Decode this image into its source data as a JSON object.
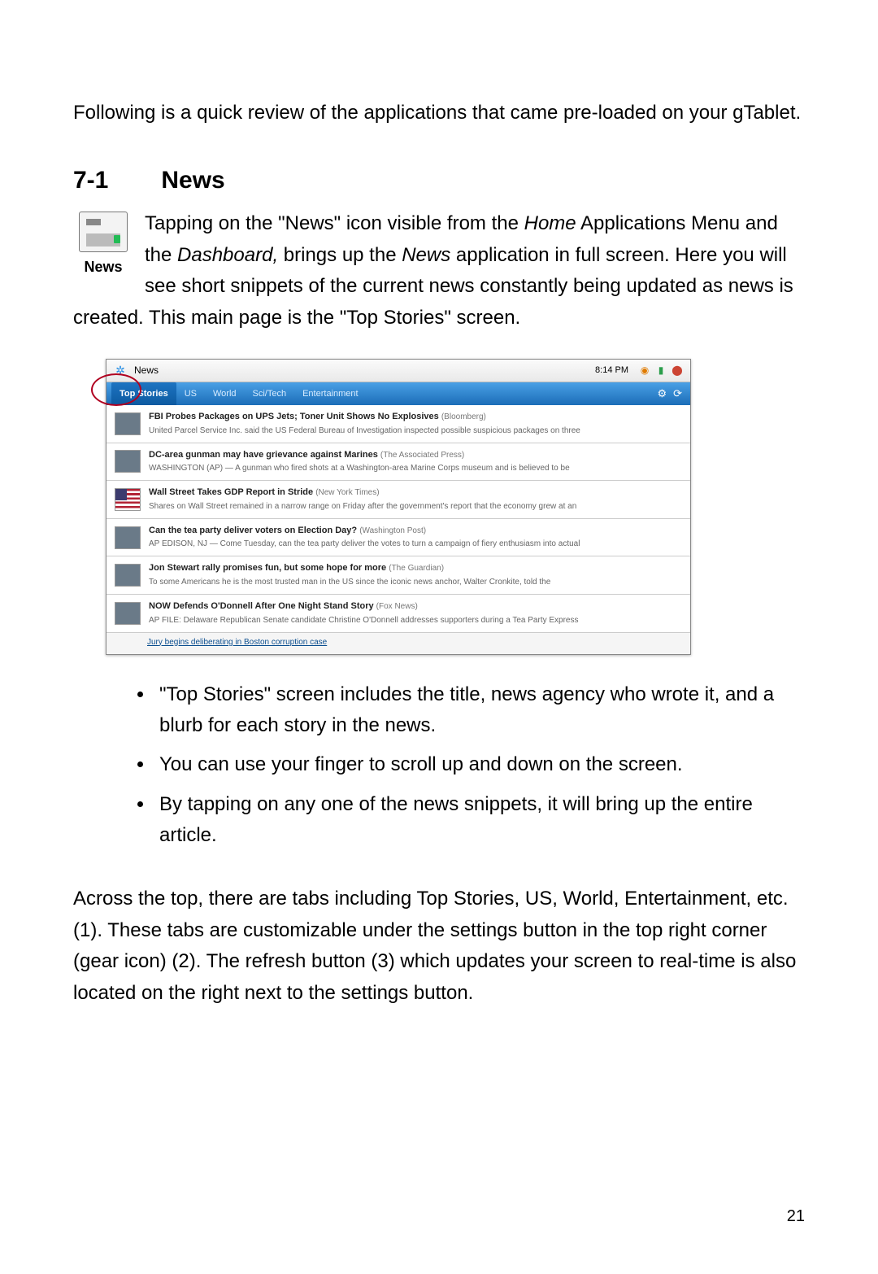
{
  "intro": "Following is a quick review of the applications that came pre-loaded on your gTablet.",
  "section": {
    "number": "7-1",
    "title": "News"
  },
  "p1a": "Tapping on the \"News\" icon visible from the ",
  "p1_home": "Home",
  "p1b": " Applications Menu and the ",
  "p1_dash": "Dashboard,",
  "p1c": " brings up the ",
  "p1_news": "News",
  "p1d": " application in full screen.    Here you will see short snippets of the current news constantly being updated as news is created.    This main page is the \"Top Stories\" screen.",
  "news_icon_label": "News",
  "screenshot": {
    "app_title": "News",
    "clock": "8:14 PM",
    "tabs": [
      "Top Stories",
      "US",
      "World",
      "Sci/Tech",
      "Entertainment"
    ],
    "gear_icon": "⚙",
    "refresh_icon": "⟳",
    "stories": [
      {
        "title": "FBI Probes Packages on UPS Jets; Toner Unit Shows No Explosives",
        "src": "(Bloomberg)",
        "blurb": "United Parcel Service Inc. said the US Federal Bureau of Investigation inspected possible suspicious packages on three",
        "thumb": ""
      },
      {
        "title": "DC-area gunman may have grievance against Marines",
        "src": "(The Associated Press)",
        "blurb": "WASHINGTON (AP) — A gunman who fired shots at a Washington-area Marine Corps museum and is believed to be",
        "thumb": ""
      },
      {
        "title": "Wall Street Takes GDP Report in Stride",
        "src": "(New York Times)",
        "blurb": "Shares on Wall Street remained in a narrow range on Friday after the government's report that the economy grew at an",
        "thumb": "flag"
      },
      {
        "title": "Can the tea party deliver voters on Election Day?",
        "src": "(Washington Post)",
        "blurb": "AP EDISON, NJ — Come Tuesday, can the tea party deliver the votes to turn a campaign of fiery enthusiasm into actual",
        "thumb": ""
      },
      {
        "title": "Jon Stewart rally promises fun, but some hope for more",
        "src": "(The Guardian)",
        "blurb": "To some Americans he is the most trusted man in the US since the iconic news anchor, Walter Cronkite, told the",
        "thumb": ""
      },
      {
        "title": "NOW Defends O'Donnell After One Night Stand Story",
        "src": "(Fox News)",
        "blurb": "AP FILE: Delaware Republican Senate candidate Christine O'Donnell addresses supporters during a Tea Party Express",
        "thumb": ""
      }
    ],
    "cutoff": "Jury begins deliberating in Boston corruption case"
  },
  "bullets": [
    "\"Top Stories\" screen includes the title, news agency who wrote it, and a blurb for each story in the news.",
    "You can use your finger to scroll up and down on the screen.",
    "By tapping on any one of the news snippets, it will bring up the entire article."
  ],
  "closing": "Across the top, there are tabs including Top Stories, US, World, Entertainment, etc. (1).    These tabs are customizable under the settings button in the top right corner (gear icon) (2).    The refresh button (3) which updates your screen to real-time is also located on the right next to the settings button.",
  "page_number": "21"
}
